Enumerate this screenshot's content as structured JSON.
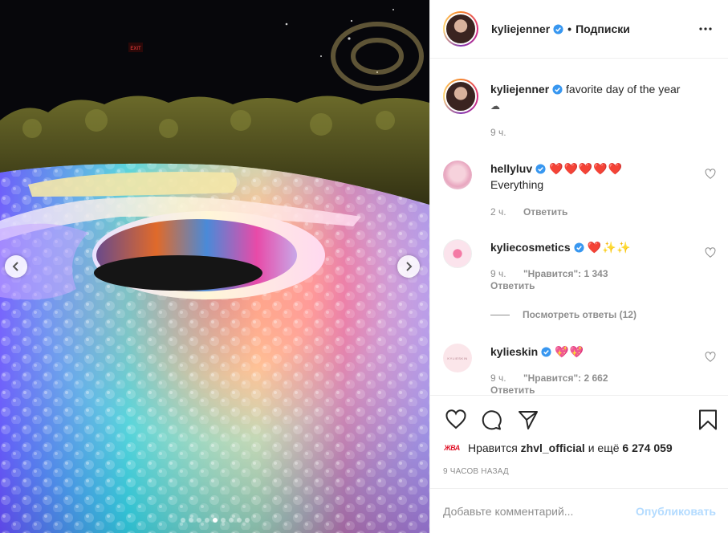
{
  "post": {
    "author": "kyliejenner",
    "follow_state": "Подписки",
    "separator": "•",
    "media": {
      "exit_sign": "EXIT",
      "carousel_total": 9,
      "carousel_active_index": 4
    }
  },
  "caption": {
    "user": "kyliejenner",
    "text": "favorite day of the year",
    "emoji": "☁",
    "time": "9 ч."
  },
  "comments": [
    {
      "user": "hellyluv",
      "verified": true,
      "text": "❤️❤️❤️❤️❤️",
      "text2": "Everything",
      "time": "2 ч.",
      "likes": "",
      "reply": "Ответить"
    },
    {
      "user": "kyliecosmetics",
      "verified": true,
      "text": "❤️✨✨",
      "time": "9 ч.",
      "likes": "\"Нравится\": 1 343",
      "reply": "Ответить",
      "view_replies": "Посмотреть ответы (12)"
    },
    {
      "user": "kylieskin",
      "verified": true,
      "text": "💖💖",
      "time": "9 ч.",
      "likes": "\"Нравится\": 2 662",
      "reply": "Ответить",
      "avatar_text": "KYLIESKIN"
    }
  ],
  "likes": {
    "badge": "ЖВА",
    "prefix": "Нравится",
    "user": "zhvl_official",
    "middle": "и ещё",
    "count": "6 274 059"
  },
  "timeago": "9 ЧАСОВ НАЗАД",
  "composer": {
    "placeholder": "Добавьте комментарий...",
    "publish": "Опубликовать"
  },
  "colors": {
    "verified": "#3897f0",
    "meta": "#8e8e8e",
    "publish_disabled": "#b3dbff",
    "heart_red": "#ed4956"
  },
  "icons": [
    "more-icon",
    "heart-icon",
    "comment-icon",
    "share-icon",
    "bookmark-icon",
    "chevron-left-icon",
    "chevron-right-icon",
    "verified-icon"
  ]
}
